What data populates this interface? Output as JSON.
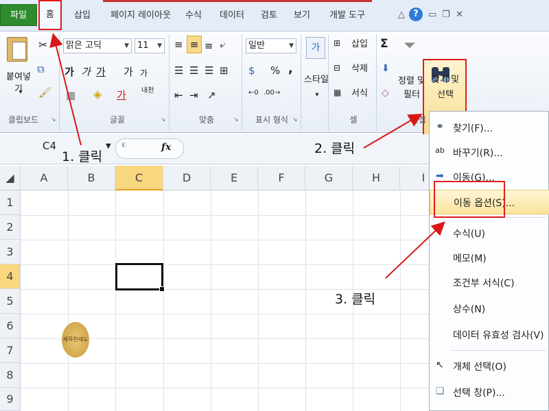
{
  "tabs": [
    "파일",
    "홈",
    "삽입",
    "페이지 레이아웃",
    "수식",
    "데이터",
    "검토",
    "보기",
    "개발 도구"
  ],
  "help_label": "?",
  "ribbon": {
    "clipboard": {
      "paste": "붙여넣기",
      "label": "클립보드"
    },
    "font": {
      "name": "맑은 고딕",
      "size": "11",
      "label": "글꼴",
      "bold": "가",
      "italic": "가",
      "underline": "가",
      "grow": "가",
      "shrink": "가",
      "color": "가",
      "phonetic": "내천"
    },
    "align": {
      "label": "맞춤"
    },
    "number": {
      "format": "일반",
      "percent": "%",
      "comma": ",",
      "label": "표시 형식"
    },
    "styles": {
      "label": "스타일"
    },
    "cells": {
      "insert": "삽입",
      "delete": "삭제",
      "format": "서식",
      "label": "셀"
    },
    "editing": {
      "sum": "Σ",
      "sort_filter_line1": "정렬 및",
      "sort_filter_line2": "필터",
      "find_select_line1": "찾기 및",
      "find_select_line2": "선택",
      "label": "편집"
    }
  },
  "formula_bar": {
    "name_box": "C4",
    "fx": "fx"
  },
  "columns": [
    "A",
    "B",
    "C",
    "D",
    "E",
    "F",
    "G",
    "H",
    "I"
  ],
  "rows": [
    "1",
    "2",
    "3",
    "4",
    "5",
    "6",
    "7",
    "8",
    "9"
  ],
  "selected_cell": "C4",
  "seal_text": "제목한세도",
  "menu": [
    {
      "label": "찾기(F)...",
      "icon": "binoculars-icon"
    },
    {
      "label": "바꾸기(R)...",
      "icon": "replace-icon"
    },
    {
      "label": "이동(G)...",
      "icon": "arrow-right-icon"
    },
    {
      "label": "이동 옵션(S)...",
      "icon": "",
      "highlighted": true
    },
    {
      "label": "수식(U)",
      "icon": ""
    },
    {
      "label": "메모(M)",
      "icon": ""
    },
    {
      "label": "조건부 서식(C)",
      "icon": ""
    },
    {
      "label": "상수(N)",
      "icon": ""
    },
    {
      "label": "데이터 유효성 검사(V)",
      "icon": ""
    },
    {
      "label": "개체 선택(O)",
      "icon": "cursor-icon"
    },
    {
      "label": "선택 창(P)...",
      "icon": "selection-pane-icon"
    }
  ],
  "annotations": {
    "step1": "1. 클릭",
    "step2": "2. 클릭",
    "step3": "3. 클릭"
  },
  "colors": {
    "highlight_red": "#e21c1c",
    "file_tab": "#2e8b2e",
    "selected_header": "#f9d77e"
  }
}
